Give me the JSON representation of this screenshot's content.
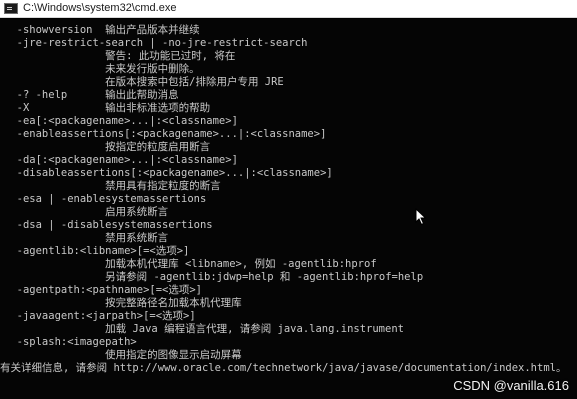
{
  "window": {
    "title": "C:\\Windows\\system32\\cmd.exe",
    "icon": "console-icon"
  },
  "console": {
    "lines": [
      "  -showversion  输出产品版本并继续",
      "  -jre-restrict-search | -no-jre-restrict-search",
      "                警告: 此功能已过时, 将在",
      "                未来发行版中删除。",
      "                在版本搜索中包括/排除用户专用 JRE",
      "  -? -help      输出此帮助消息",
      "  -X            输出非标准选项的帮助",
      "  -ea[:<packagename>...|:<classname>]",
      "  -enableassertions[:<packagename>...|:<classname>]",
      "                按指定的粒度启用断言",
      "  -da[:<packagename>...|:<classname>]",
      "  -disableassertions[:<packagename>...|:<classname>]",
      "                禁用具有指定粒度的断言",
      "  -esa | -enablesystemassertions",
      "                启用系统断言",
      "  -dsa | -disablesystemassertions",
      "                禁用系统断言",
      "  -agentlib:<libname>[=<选项>]",
      "                加载本机代理库 <libname>, 例如 -agentlib:hprof",
      "                另请参阅 -agentlib:jdwp=help 和 -agentlib:hprof=help",
      "  -agentpath:<pathname>[=<选项>]",
      "                按完整路径名加载本机代理库",
      "  -javaagent:<jarpath>[=<选项>]",
      "                加载 Java 编程语言代理, 请参阅 java.lang.instrument",
      "  -splash:<imagepath>",
      "                使用指定的图像显示启动屏幕",
      "有关详细信息, 请参阅 http://www.oracle.com/technetwork/java/javase/documentation/index.html。"
    ]
  },
  "watermark": "CSDN @vanilla.616",
  "colors": {
    "console_bg": "#050505",
    "console_text": "#c9c9c9",
    "titlebar_bg": "#ffffff"
  }
}
